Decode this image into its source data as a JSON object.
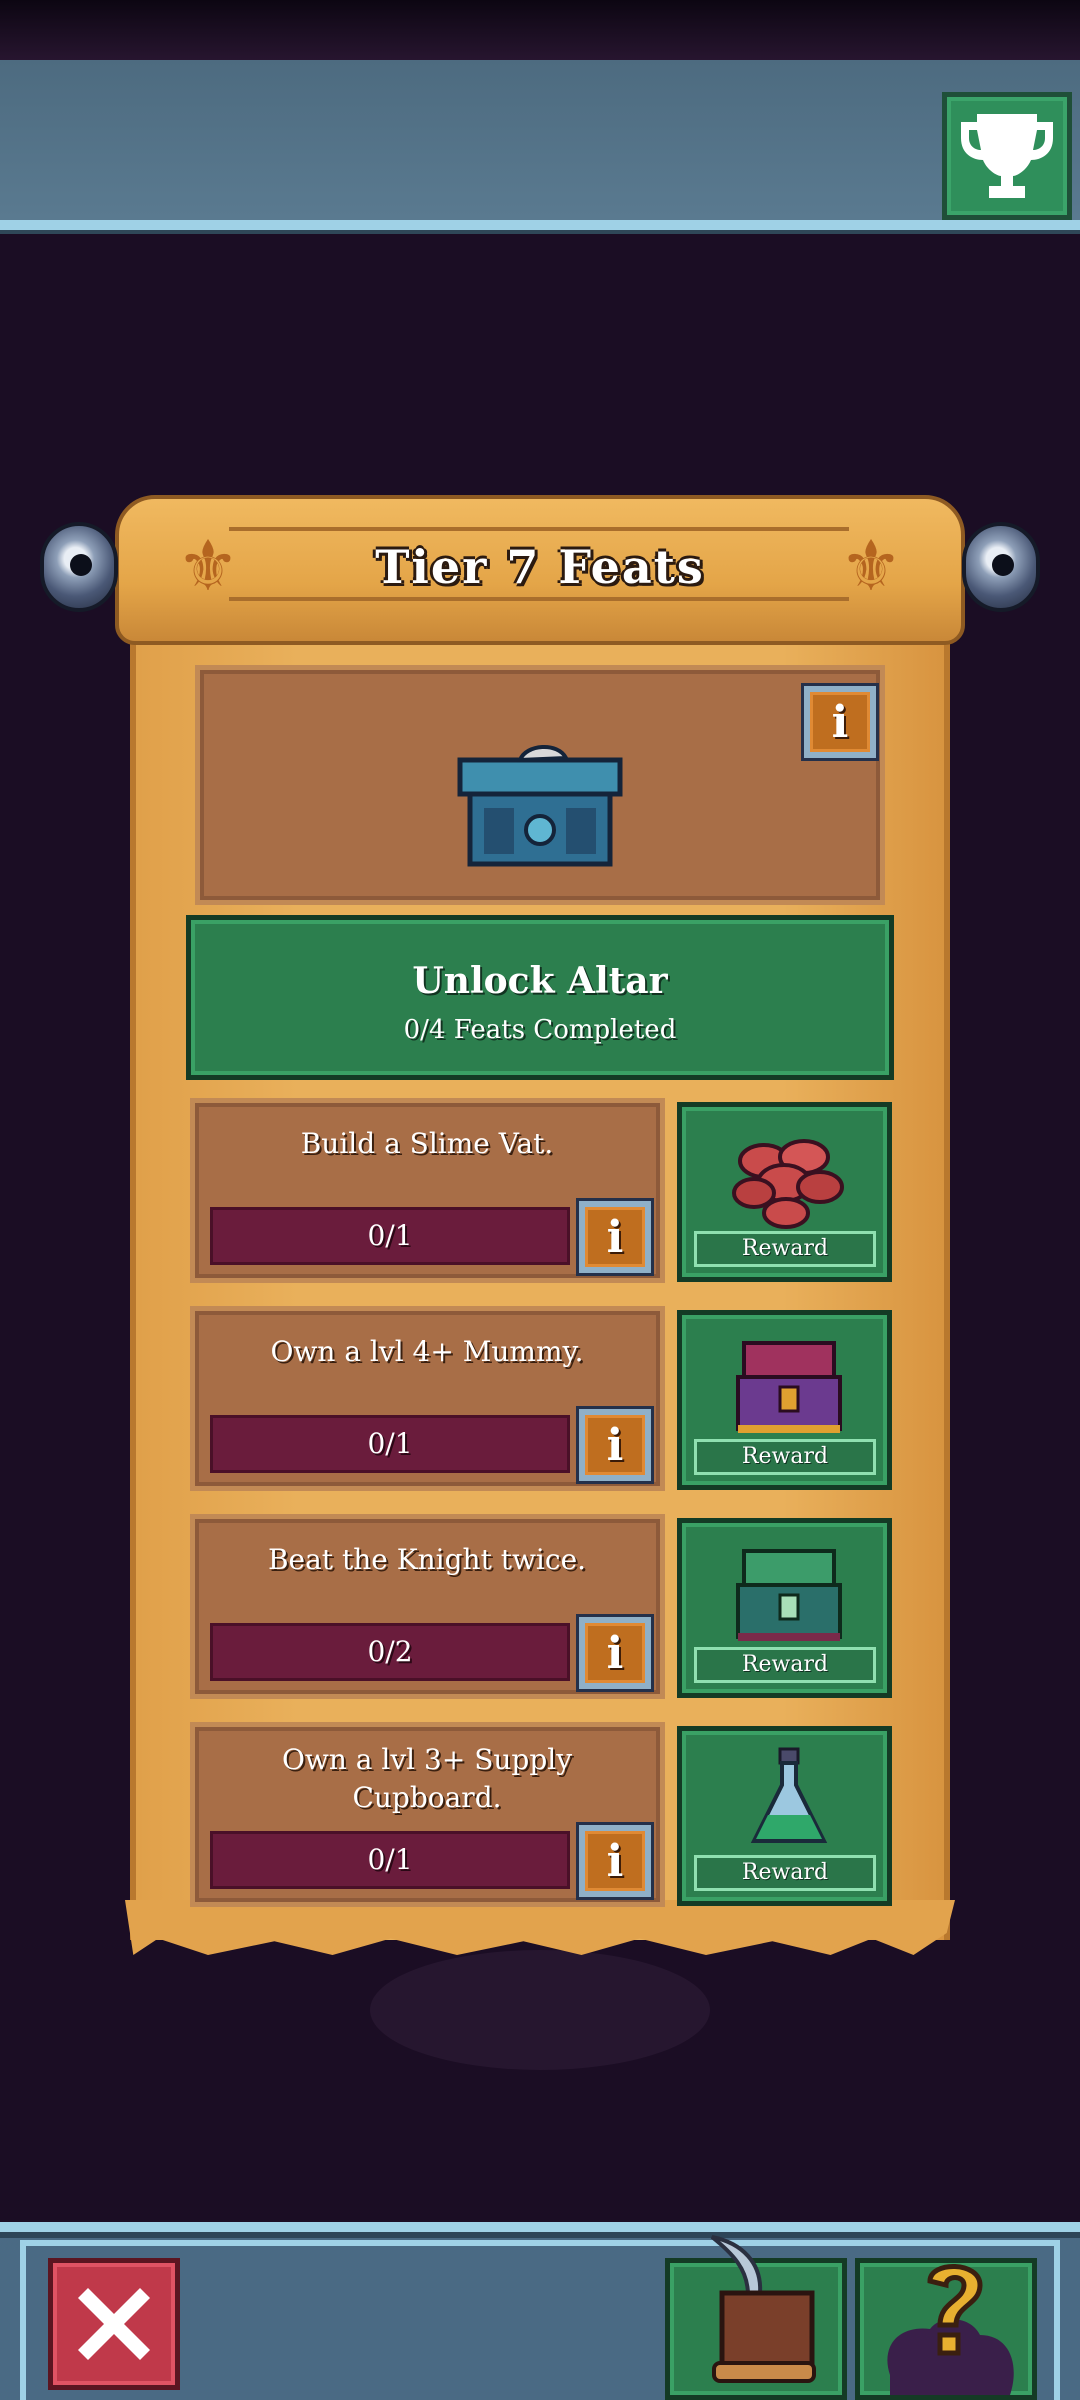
{
  "header": {
    "trophy_icon": "trophy-icon"
  },
  "scroll": {
    "title": "Tier 7 Feats"
  },
  "altar": {
    "icon": "altar-chest-icon",
    "info_glyph": "i",
    "unlock_title": "Unlock Altar",
    "unlock_status": "0/4 Feats Completed"
  },
  "feats": [
    {
      "description": "Build a Slime Vat.",
      "progress": "0/1",
      "info_glyph": "i",
      "reward_label": "Reward",
      "reward_icon": "coins-icon"
    },
    {
      "description": "Own a lvl 4+ Mummy.",
      "progress": "0/1",
      "info_glyph": "i",
      "reward_label": "Reward",
      "reward_icon": "purple-chest-icon"
    },
    {
      "description": "Beat the Knight twice.",
      "progress": "0/2",
      "info_glyph": "i",
      "reward_label": "Reward",
      "reward_icon": "green-chest-icon"
    },
    {
      "description": "Own a lvl 3+ Supply Cupboard.",
      "progress": "0/1",
      "info_glyph": "i",
      "reward_label": "Reward",
      "reward_icon": "potion-flask-icon"
    }
  ],
  "footer": {
    "close_icon": "close-icon",
    "quest_scroll_icon": "quill-scroll-icon",
    "help_icon": "question-mark-icon"
  },
  "colors": {
    "panel_green": "#2c7f4e",
    "parchment": "#e9b05b",
    "progress_bar": "#6a1c3c",
    "close_red": "#c0394a"
  }
}
